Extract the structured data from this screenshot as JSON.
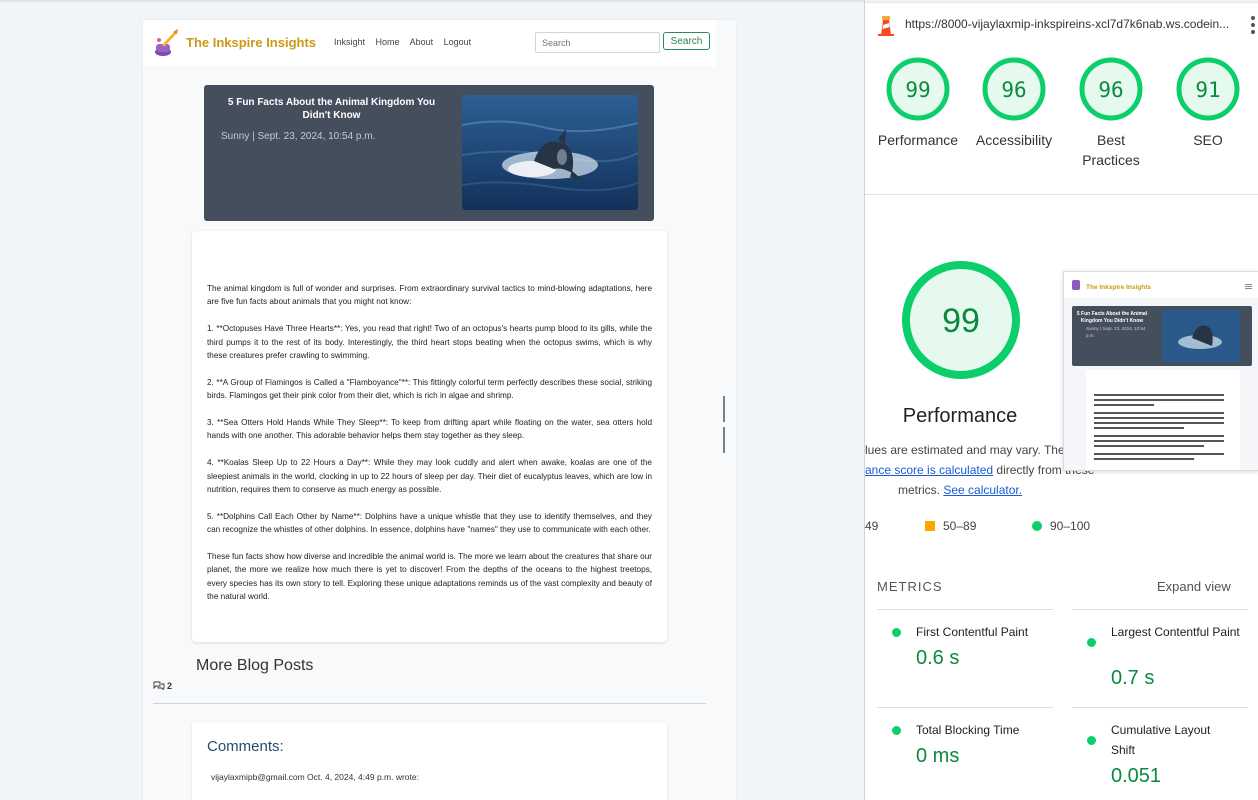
{
  "site": {
    "brand": "The Inkspire Insights",
    "nav": [
      "Inksight",
      "Home",
      "About",
      "Logout"
    ],
    "search": {
      "placeholder": "Search",
      "button": "Search"
    },
    "hero": {
      "title": "5 Fun Facts About the Animal Kingdom You Didn't Know",
      "meta": "Sunny | Sept. 23, 2024, 10:54 p.m."
    },
    "article": {
      "paragraphs": [
        "The animal kingdom is full of wonder and surprises. From extraordinary survival tactics to mind-blowing adaptations, here are five fun facts about animals that you might not know:",
        "1. **Octopuses Have Three Hearts**: Yes, you read that right! Two of an octopus's hearts pump blood to its gills, while the third pumps it to the rest of its body. Interestingly, the third heart stops beating when the octopus swims, which is why these creatures prefer crawling to swimming.",
        "2. **A Group of Flamingos is Called a \"Flamboyance\"**: This fittingly colorful term perfectly describes these social, striking birds. Flamingos get their pink color from their diet, which is rich in algae and shrimp.",
        "3. **Sea Otters Hold Hands While They Sleep**: To keep from drifting apart while floating on the water, sea otters hold hands with one another. This adorable behavior helps them stay together as they sleep.",
        "4. **Koalas Sleep Up to 22 Hours a Day**: While they may look cuddly and alert when awake, koalas are one of the sleepiest animals in the world, clocking in up to 22 hours of sleep per day. Their diet of eucalyptus leaves, which are low in nutrition, requires them to conserve as much energy as possible.",
        "5. **Dolphins Call Each Other by Name**: Dolphins have a unique whistle that they use to identify themselves, and they can recognize the whistles of other dolphins. In essence, dolphins have \"names\" they use to communicate with each other.",
        "These fun facts show how diverse and incredible the animal world is. The more we learn about the creatures that share our planet, the more we realize how much there is yet to discover! From the depths of the oceans to the highest treetops, every species has its own story to tell. Exploring these unique adaptations reminds us of the vast complexity and beauty of the natural world."
      ]
    },
    "more_title": "More Blog Posts",
    "comment_count": "2",
    "comments_title": "Comments:",
    "comment_line": "vijaylaxmipb@gmail.com Oct. 4, 2024, 4:49 p.m. wrote:"
  },
  "lighthouse": {
    "url": "https://8000-vijaylaxmip-inkspireins-xcl7d7k6nab.ws.codein...",
    "scores": [
      {
        "label": "Performance",
        "score": 99
      },
      {
        "label": "Accessibility",
        "score": 96
      },
      {
        "label": "Best Practices",
        "score": 96
      },
      {
        "label": "SEO",
        "score": 91
      }
    ],
    "main": {
      "score": "99",
      "label": "Performance"
    },
    "estimate": {
      "line1": "lues are estimated and may vary. The",
      "link1": "ance score is calculated",
      "line2_rest": " directly from these",
      "line3_prefix": "metrics. ",
      "link2": "See calculator."
    },
    "legend": {
      "low": "49",
      "mid": "50–89",
      "high": "90–100"
    },
    "metrics_heading": "METRICS",
    "expand_label": "Expand view",
    "metrics": [
      {
        "name": "First Contentful Paint",
        "value": "0.6 s"
      },
      {
        "name": "Largest Contentful Paint",
        "value": "0.7 s"
      },
      {
        "name": "Total Blocking Time",
        "value": "0 ms"
      },
      {
        "name": "Cumulative Layout Shift",
        "value": "0.051"
      }
    ],
    "thumb": {
      "brand": "The Inkspire Insights",
      "title": "5 Fun Facts About the Animal Kingdom You Didn't Know",
      "meta": "Sunny | Sept. 23, 2024, 10:54 p.m."
    },
    "colors": {
      "pass": "#0cce6b",
      "pass_text": "#0b8a3d",
      "average": "#ffa400"
    }
  }
}
